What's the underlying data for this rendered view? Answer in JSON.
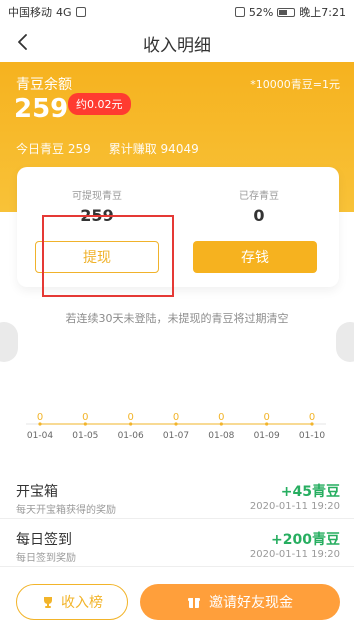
{
  "statusbar": {
    "carrier": "中国移动",
    "signal": "4G",
    "battery": "52%",
    "time": "晚上7:21"
  },
  "nav": {
    "title": "收入明细"
  },
  "balance": {
    "label": "青豆余额",
    "rate": "*10000青豆=1元",
    "amount": "259",
    "approx": "约0.02元",
    "today": "今日青豆 259",
    "total": "累计赚取 94049"
  },
  "card": {
    "withdrawable_label": "可提现青豆",
    "withdrawable_value": "259",
    "saved_label": "已存青豆",
    "saved_value": "0",
    "withdraw_button": "提现",
    "save_button": "存钱"
  },
  "notice": "若连续30天未登陆，未提现的青豆将过期清空",
  "chart_data": {
    "type": "line",
    "categories": [
      "01-04",
      "01-05",
      "01-06",
      "01-07",
      "01-08",
      "01-09",
      "01-10"
    ],
    "values": [
      0,
      0,
      0,
      0,
      0,
      0,
      0
    ],
    "title": "",
    "xlabel": "",
    "ylabel": "",
    "ylim": [
      0,
      1
    ],
    "grid": false,
    "legend": "none",
    "color": "#f2b42a"
  },
  "list": [
    {
      "title": "开宝箱",
      "desc": "每天开宝箱获得的奖励",
      "amount": "+45青豆",
      "time": "2020-01-11 19:20"
    },
    {
      "title": "每日签到",
      "desc": "每日签到奖励",
      "amount": "+200青豆",
      "time": "2020-01-11 19:20"
    }
  ],
  "bottom": {
    "rank_label": "收入榜",
    "invite_label": "邀请好友现金"
  },
  "colors": {
    "primary": "#f6b21f",
    "accent_red": "#ff3b30",
    "success": "#27ae60",
    "invite": "#ff9f3b"
  }
}
